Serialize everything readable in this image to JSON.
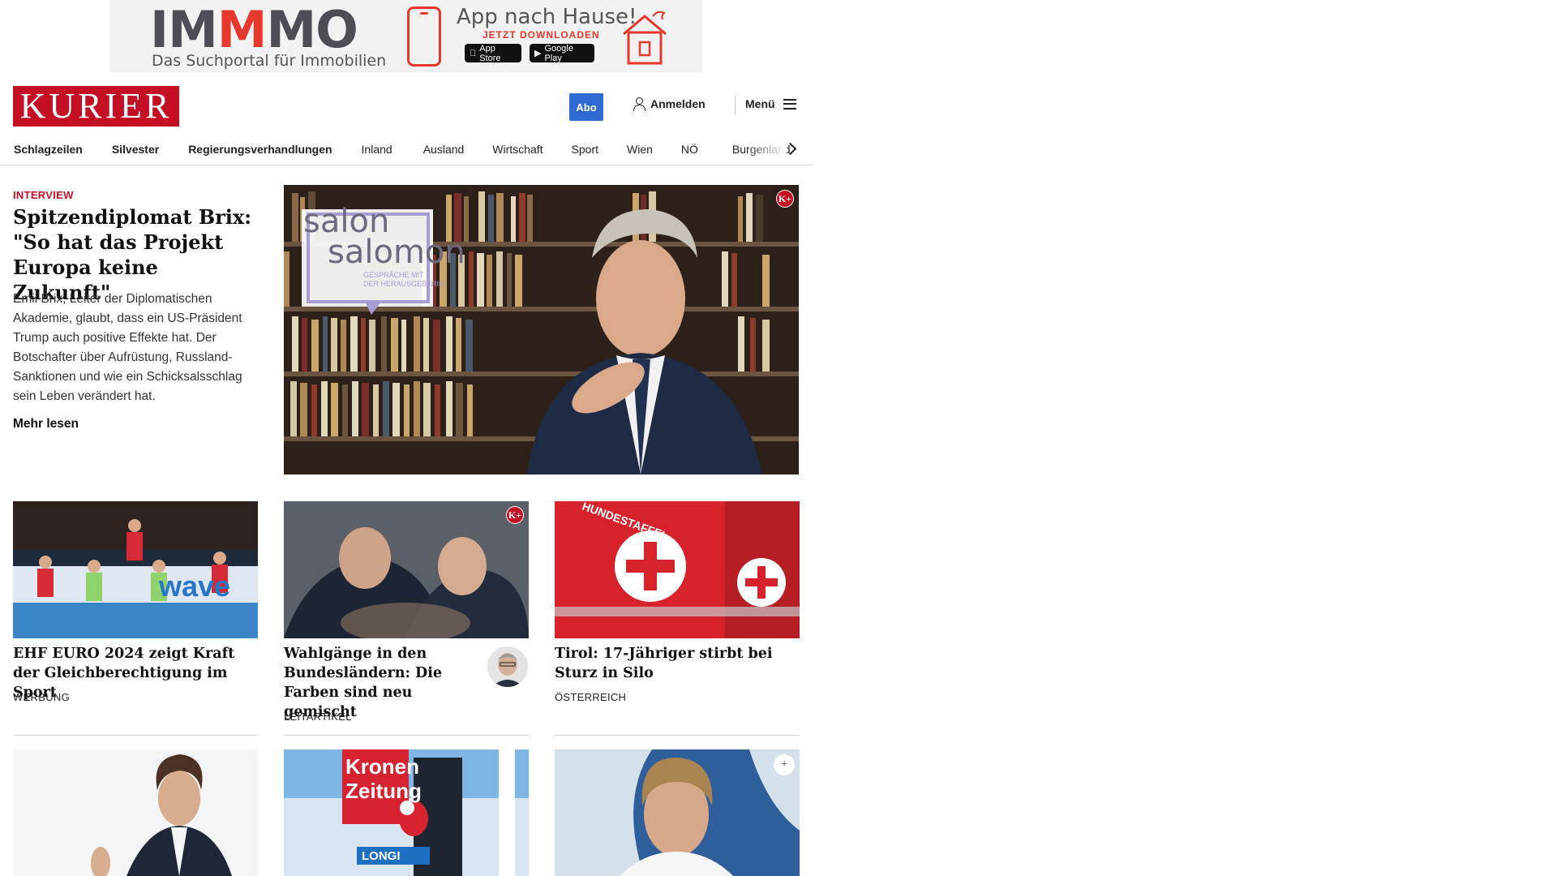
{
  "ad": {
    "logo_part1": "IM",
    "logo_part2": "M",
    "logo_part3": "MO",
    "subtitle": "Das Suchportal für Immobilien",
    "title": "App nach Hause!",
    "cta": "JETZT DOWNLOADEN",
    "store1": "App Store",
    "store2": "Google Play"
  },
  "header": {
    "logo": "KURIER",
    "abo": "Abo",
    "login": "Anmelden",
    "menu": "Menü"
  },
  "nav": {
    "items": [
      "Schlagzeilen",
      "Silvester",
      "Regierungsverhandlungen",
      "Inland",
      "Ausland",
      "Wirtschaft",
      "Sport",
      "Wien",
      "NÖ",
      "Burgenland"
    ]
  },
  "hero": {
    "kicker": "INTERVIEW",
    "title": "Spitzendiplomat Brix: \"So hat das Projekt Europa keine Zukunft\"",
    "text": "Emil Brix, Leiter der Diplomatischen Akademie, glaubt, dass ein US-Präsident Trump auch positive Effekte hat. Der Botschafter über Aufrüstung, Russland-Sanktionen und wie ein Schicksalsschlag sein Leben verändert hat.",
    "more": "Mehr lesen",
    "image_text_1": "salon",
    "image_text_2": "salomon",
    "image_text_3": "GESPRÄCHE MIT",
    "image_text_4": "DER HERAUSGEBERIN",
    "badge": "K+"
  },
  "cards": [
    {
      "title": "EHF EURO 2024 zeigt Kraft der Gleichberechtigung im Sport",
      "label": "WERBUNG",
      "image_text": "wave"
    },
    {
      "title": "Wahlgänge in den Bundes­ländern: Die Farben sind neu gemischt",
      "label": "LEITARTIKEL",
      "badge": "K+"
    },
    {
      "title": "Tirol: 17-Jähriger stirbt bei Sturz in Silo",
      "label": "ÖSTERREICH",
      "image_text": "HUNDESTAFFEL"
    }
  ],
  "row2": {
    "card2_text_1": "Kronen",
    "card2_text_2": "Zeitung",
    "card2_text_3": "LONGI",
    "card3_badge": "+"
  }
}
